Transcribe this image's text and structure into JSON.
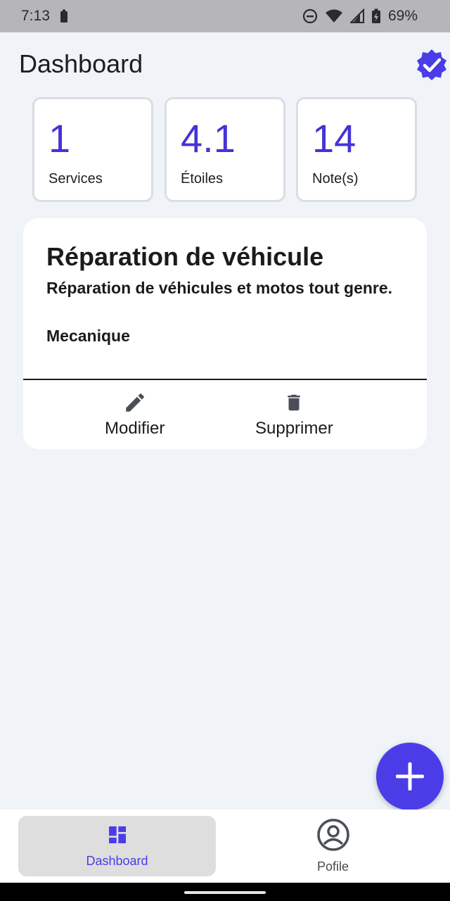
{
  "status_bar": {
    "time": "7:13",
    "battery_percent": "69%",
    "icons": [
      "battery-small-icon",
      "do-not-disturb-icon",
      "wifi-icon",
      "cell-signal-icon",
      "battery-charging-icon"
    ]
  },
  "header": {
    "title": "Dashboard",
    "badge_icon": "verified-badge-icon",
    "badge_color": "#4a3de8"
  },
  "stats": [
    {
      "value": "1",
      "label": "Services"
    },
    {
      "value": "4.1",
      "label": "Étoiles"
    },
    {
      "value": "14",
      "label": "Note(s)"
    }
  ],
  "service": {
    "title": "Réparation de véhicule",
    "description": "Réparation de véhicules et motos tout genre.",
    "category": "Mecanique",
    "actions": [
      {
        "label": "Modifier",
        "icon": "pencil-icon"
      },
      {
        "label": "Supprimer",
        "icon": "trash-icon"
      }
    ]
  },
  "fab": {
    "icon": "plus-icon"
  },
  "bottom_nav": {
    "items": [
      {
        "label": "Dashboard",
        "icon": "dashboard-icon",
        "active": true
      },
      {
        "label": "Pofile",
        "icon": "account-circle-icon",
        "active": false
      }
    ]
  },
  "colors": {
    "accent": "#4a3de8",
    "stat_value": "#4533d6",
    "background": "#f0f3f8"
  }
}
